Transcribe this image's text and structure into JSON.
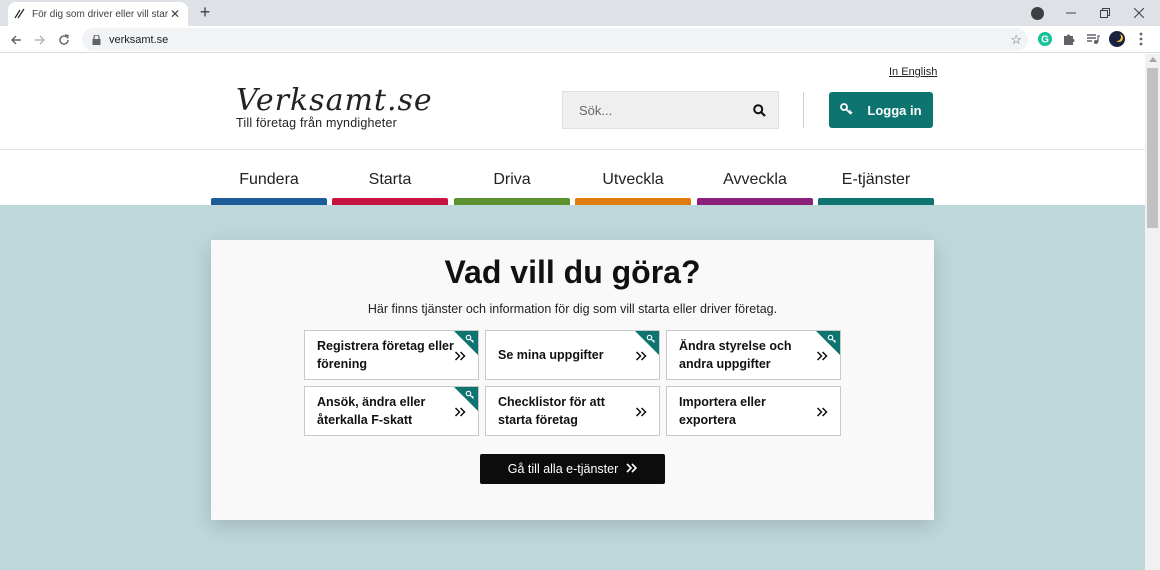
{
  "browser": {
    "tab_title": "För dig som driver eller vill starta",
    "url": "verksamt.se"
  },
  "header": {
    "english_link": "In English",
    "logo_wordmark": "Verksamt.se",
    "logo_tagline": "Till företag från myndigheter",
    "search_placeholder": "Sök...",
    "login_label": "Logga in"
  },
  "nav": {
    "items": [
      {
        "label": "Fundera",
        "color": "#1d5b99"
      },
      {
        "label": "Starta",
        "color": "#c8123f"
      },
      {
        "label": "Driva",
        "color": "#5c9130"
      },
      {
        "label": "Utveckla",
        "color": "#e07c0e"
      },
      {
        "label": "Avveckla",
        "color": "#8a2079"
      },
      {
        "label": "E-tjänster",
        "color": "#0e7470"
      }
    ]
  },
  "main": {
    "heading": "Vad vill du göra?",
    "intro": "Här finns tjänster och information för dig som vill starta eller driver företag.",
    "services": [
      {
        "label": "Registrera företag eller förening",
        "requires_login": true
      },
      {
        "label": "Se mina uppgifter",
        "requires_login": true
      },
      {
        "label": "Ändra styrelse och andra uppgifter",
        "requires_login": true
      },
      {
        "label": "Ansök, ändra eller återkalla F-skatt",
        "requires_login": true
      },
      {
        "label": "Checklistor för att starta företag",
        "requires_login": false
      },
      {
        "label": "Importera eller exportera",
        "requires_login": false
      }
    ],
    "all_services_label": "Gå till alla e-tjänster"
  },
  "colors": {
    "accent": "#0e7470",
    "hero_background": "#bdd7da"
  }
}
